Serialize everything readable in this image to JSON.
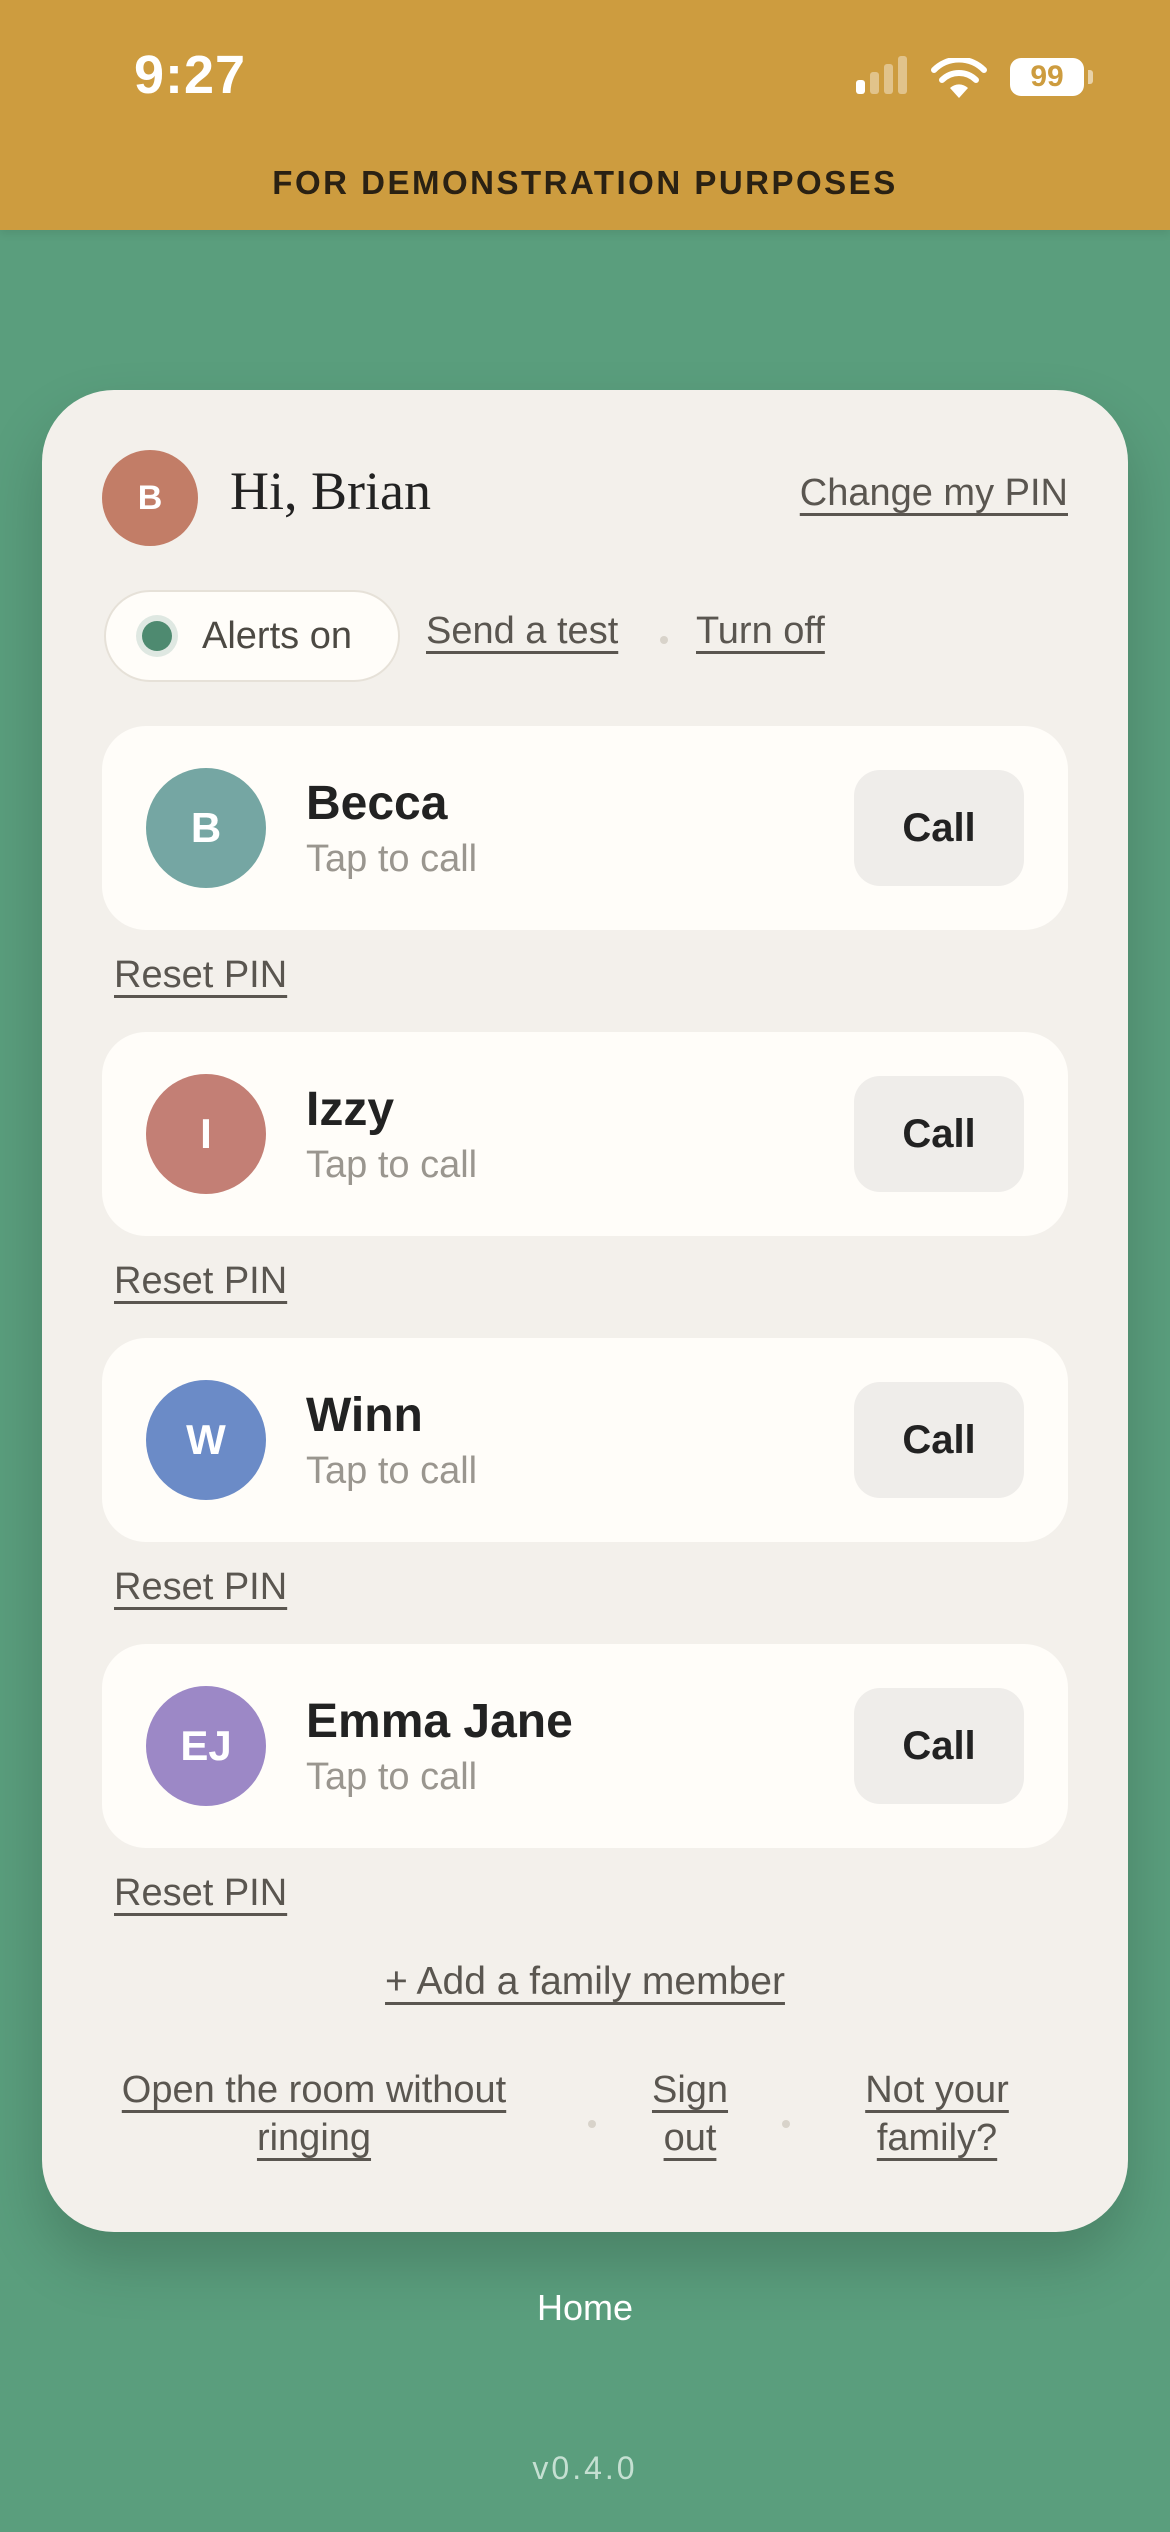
{
  "status_bar": {
    "time": "9:27",
    "battery": "99",
    "icons": [
      "cellular-signal-icon",
      "wifi-icon",
      "battery-icon"
    ]
  },
  "banner": {
    "text": "FOR DEMONSTRATION PURPOSES"
  },
  "colors": {
    "background": "#5a9e7d",
    "banner": "#cd9c3f",
    "card": "#f3f0eb",
    "alerts_dot": "#4e8a70"
  },
  "header": {
    "avatar_initial": "B",
    "avatar_color": "#c27d67",
    "greeting": "Hi, Brian",
    "change_pin": "Change my PIN"
  },
  "alerts": {
    "status_label": "Alerts on",
    "send_test": "Send a test",
    "turn_off": "Turn off"
  },
  "members": [
    {
      "initials": "B",
      "name": "Becca",
      "subtitle": "Tap to call",
      "call": "Call",
      "reset": "Reset PIN",
      "color": "#75a6a3"
    },
    {
      "initials": "I",
      "name": "Izzy",
      "subtitle": "Tap to call",
      "call": "Call",
      "reset": "Reset PIN",
      "color": "#c37f75"
    },
    {
      "initials": "W",
      "name": "Winn",
      "subtitle": "Tap to call",
      "call": "Call",
      "reset": "Reset PIN",
      "color": "#6b8bc7"
    },
    {
      "initials": "EJ",
      "name": "Emma Jane",
      "subtitle": "Tap to call",
      "call": "Call",
      "reset": "Reset PIN",
      "color": "#9c88c6"
    }
  ],
  "add_member": "+ Add a family member",
  "footer": {
    "open_room_line1": "Open the room without",
    "open_room_line2": "ringing",
    "sign_out_line1": "Sign",
    "sign_out_line2": "out",
    "not_family_line1": "Not your",
    "not_family_line2": "family?"
  },
  "home": "Home",
  "version": "v0.4.0"
}
